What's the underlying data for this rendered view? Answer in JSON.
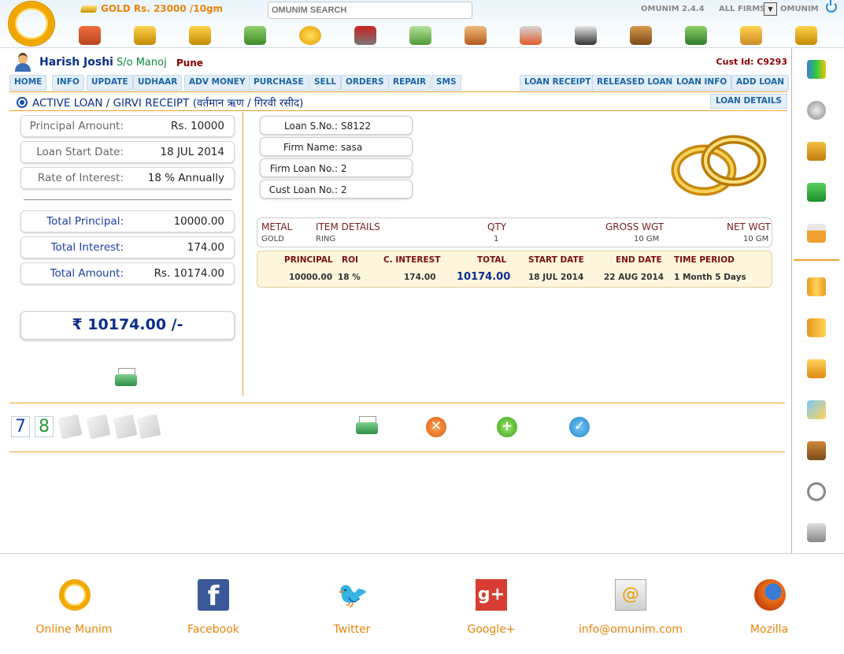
{
  "header": {
    "gold_rate": "GOLD Rs. 23000 /10gm",
    "search_placeholder": "OMUNIM SEARCH",
    "version": "OMUNIM 2.4.4",
    "firm_select_label": "ALL FIRMS",
    "firm_select_arrow": "▼",
    "user": "OMUNIM",
    "toolbar_icons": [
      "home-icon",
      "gold-coins-add-icon",
      "gold-coins-icon",
      "money-hand-icon",
      "new-badge-icon",
      "tools-icon",
      "money-bill-icon",
      "person-icon",
      "person-add-icon",
      "supplier-icon",
      "money-bag-icon",
      "cash-stack-icon",
      "coins-hand-icon",
      "bar-chart-icon"
    ]
  },
  "customer": {
    "name": "Harish Joshi",
    "relation": "S/o Manoj",
    "city": "Pune",
    "cust_id_label": "Cust Id:",
    "cust_id": "C9293"
  },
  "nav": {
    "left": [
      "HOME",
      "INFO",
      "UPDATE",
      "UDHAAR",
      "ADV MONEY",
      "PURCHASE",
      "SELL",
      "ORDERS",
      "REPAIR",
      "SMS"
    ],
    "right": [
      "LOAN RECEIPT",
      "RELEASED LOAN",
      "LOAN INFO",
      "ADD LOAN"
    ]
  },
  "page": {
    "title": "ACTIVE LOAN / GIRVI RECEIPT (वर्तमान ऋण / गिरवी रसीद)",
    "loan_details_button": "LOAN DETAILS"
  },
  "summary": {
    "principal_label": "Principal Amount:",
    "principal_value": "Rs. 10000",
    "start_label": "Loan Start Date:",
    "start_value": "18 JUL 2014",
    "roi_label": "Rate of Interest:",
    "roi_value": "18 % Annually",
    "total_principal_label": "Total Principal:",
    "total_principal_value": "10000.00",
    "total_interest_label": "Total Interest:",
    "total_interest_value": "174.00",
    "total_amount_label": "Total Amount:",
    "total_amount_value": "Rs. 10174.00",
    "grand_total": "₹ 10174.00 /-"
  },
  "loan": {
    "sno_label": "Loan S.No.:",
    "sno_value": "S8122",
    "firm_label": "Firm Name:",
    "firm_value": "sasa",
    "firm_loan_label": "Firm Loan No.:",
    "firm_loan_value": "2",
    "cust_loan_label": "Cust Loan No.:",
    "cust_loan_value": "2"
  },
  "items": {
    "headers": [
      "METAL",
      "ITEM DETAILS",
      "QTY",
      "GROSS WGT",
      "NET WGT"
    ],
    "row": [
      "GOLD",
      "RING",
      "1",
      "10 GM",
      "10 GM"
    ]
  },
  "calc": {
    "headers": [
      "PRINCIPAL",
      "ROI",
      "C. INTEREST",
      "TOTAL",
      "START DATE",
      "END DATE",
      "TIME PERIOD"
    ],
    "row": [
      "10000.00",
      "18 %",
      "174.00",
      "10174.00",
      "18 JUL 2014",
      "22 AUG 2014",
      "1 Month 5 Days"
    ]
  },
  "actions": {
    "num7": "7",
    "num8": "8",
    "cancel_glyph": "✕",
    "add_glyph": "+",
    "confirm_glyph": "✓"
  },
  "sidebar_icons": [
    "report-chart-icon",
    "settings-gear-icon",
    "hierarchy-icon",
    "sms-icon",
    "calendar-icon",
    "ledger-icon",
    "notebook-icon",
    "bar-graph-icon",
    "puzzle-icon",
    "scale-icon",
    "stopwatch-icon",
    "calculator-icon"
  ],
  "footer": {
    "links": [
      "Online Munim",
      "Facebook",
      "Twitter",
      "Google+",
      "info@omunim.com",
      "Mozilla"
    ],
    "fb_glyph": "f",
    "tw_glyph": "🐦",
    "gp_glyph": "g+",
    "mail_glyph": "@"
  },
  "colors": {
    "accent": "#f0a030",
    "nav_text": "#1f64a6",
    "title_blue": "#0a2e8c"
  }
}
